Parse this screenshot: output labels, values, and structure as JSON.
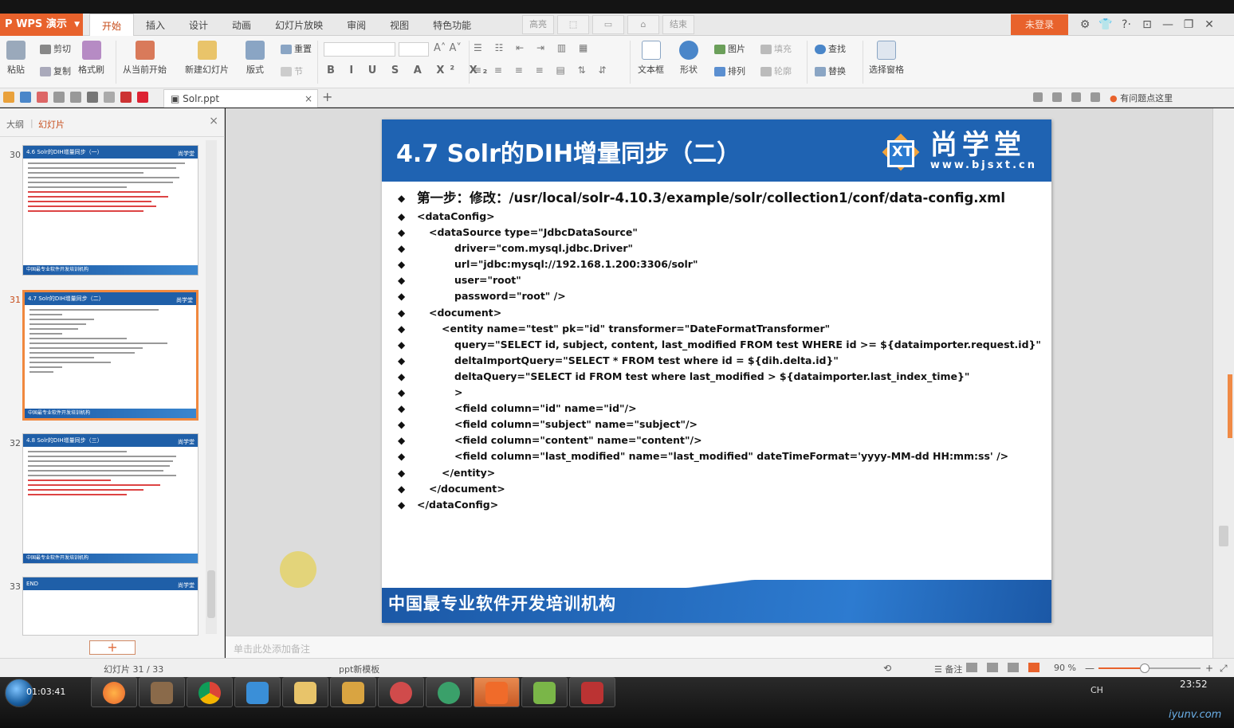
{
  "app": {
    "name": "WPS 演示",
    "login": "未登录",
    "menu": [
      "开始",
      "插入",
      "设计",
      "动画",
      "幻灯片放映",
      "审阅",
      "视图",
      "特色功能"
    ],
    "menu_tools": [
      "高亮",
      "",
      "",
      "",
      "结束"
    ],
    "window_controls": [
      "⚙",
      "👕",
      "?·",
      "⊡",
      "—",
      "❐",
      "✕"
    ]
  },
  "ribbon": {
    "paste": "粘贴",
    "cut": "剪切",
    "copy": "复制",
    "format_painter": "格式刷",
    "from_current": "从当前开始",
    "new_slide": "新建幻灯片",
    "layout": "版式",
    "reset": "重置",
    "section": "节",
    "font_format": "B I U S A X² X₂",
    "textbox": "文本框",
    "shape": "形状",
    "picture": "图片",
    "fill": "填充",
    "arrange": "排列",
    "outline": "轮廓",
    "find": "查找",
    "replace": "替换",
    "select_pane": "选择窗格"
  },
  "qbar": {
    "doc_tab": "Solr.ppt",
    "help": "有问题点这里"
  },
  "left_panel": {
    "tab_outline": "大纲",
    "tab_slides": "幻灯片",
    "thumbs": [
      {
        "num": "30",
        "title": "4.6 Solr的DIH增量同步（一）",
        "logo": "尚学堂",
        "foot": "中国最专业软件开发培训机构"
      },
      {
        "num": "31",
        "title": "4.7 Solr的DIH增量同步（二）",
        "logo": "尚学堂",
        "foot": "中国最专业软件开发培训机构"
      },
      {
        "num": "32",
        "title": "4.8 Solr的DIH增量同步（三）",
        "logo": "尚学堂",
        "foot": "中国最专业软件开发培训机构"
      },
      {
        "num": "33",
        "title": "END",
        "logo": "尚学堂",
        "foot": ""
      }
    ],
    "add_slide": "+"
  },
  "slide": {
    "title": "4.7 Solr的DIH增量同步（二）",
    "logo_cn": "尚学堂",
    "logo_url": "www.bjsxt.cn",
    "logo_letters": "XT",
    "bullet": "◆",
    "lines": [
      "第一步：修改：/usr/local/solr-4.10.3/example/solr/collection1/conf/data-config.xml",
      "<dataConfig>",
      "<dataSource type=\"JdbcDataSource\"",
      "driver=\"com.mysql.jdbc.Driver\"",
      "url=\"jdbc:mysql://192.168.1.200:3306/solr\"",
      "user=\"root\"",
      "password=\"root\" />",
      "<document>",
      "<entity name=\"test\" pk=\"id\" transformer=\"DateFormatTransformer\"",
      "query=\"SELECT id, subject, content, last_modified FROM test WHERE id >= ${dataimporter.request.id}\"",
      "deltaImportQuery=\"SELECT * FROM test where id = ${dih.delta.id}\"",
      "deltaQuery=\"SELECT id FROM test where last_modified > ${dataimporter.last_index_time}\"",
      ">",
      "<field column=\"id\" name=\"id\"/>",
      "<field column=\"subject\" name=\"subject\"/>",
      "<field column=\"content\" name=\"content\"/>",
      "<field column=\"last_modified\" name=\"last_modified\" dateTimeFormat='yyyy-MM-dd HH:mm:ss' />",
      "</entity>",
      "</document>",
      "</dataConfig>"
    ],
    "indents": [
      0,
      0,
      1,
      3,
      3,
      3,
      3,
      1,
      2,
      3,
      3,
      3,
      3,
      3,
      3,
      3,
      3,
      2,
      1,
      0
    ],
    "footer": "中国最专业软件开发培训机构"
  },
  "notes_placeholder": "单击此处添加备注",
  "status": {
    "slide_count": "幻灯片 31 / 33",
    "template": "ppt新模板",
    "notes": "备注",
    "zoom": "90 %",
    "zoom_level": 0.45
  },
  "taskbar": {
    "left_clock": "01:03:41",
    "tray": "CH",
    "clock": "23:52",
    "watermark": "iyunv.com"
  },
  "colors": {
    "accent": "#e8622c",
    "slide_blue": "#1f63b2"
  }
}
